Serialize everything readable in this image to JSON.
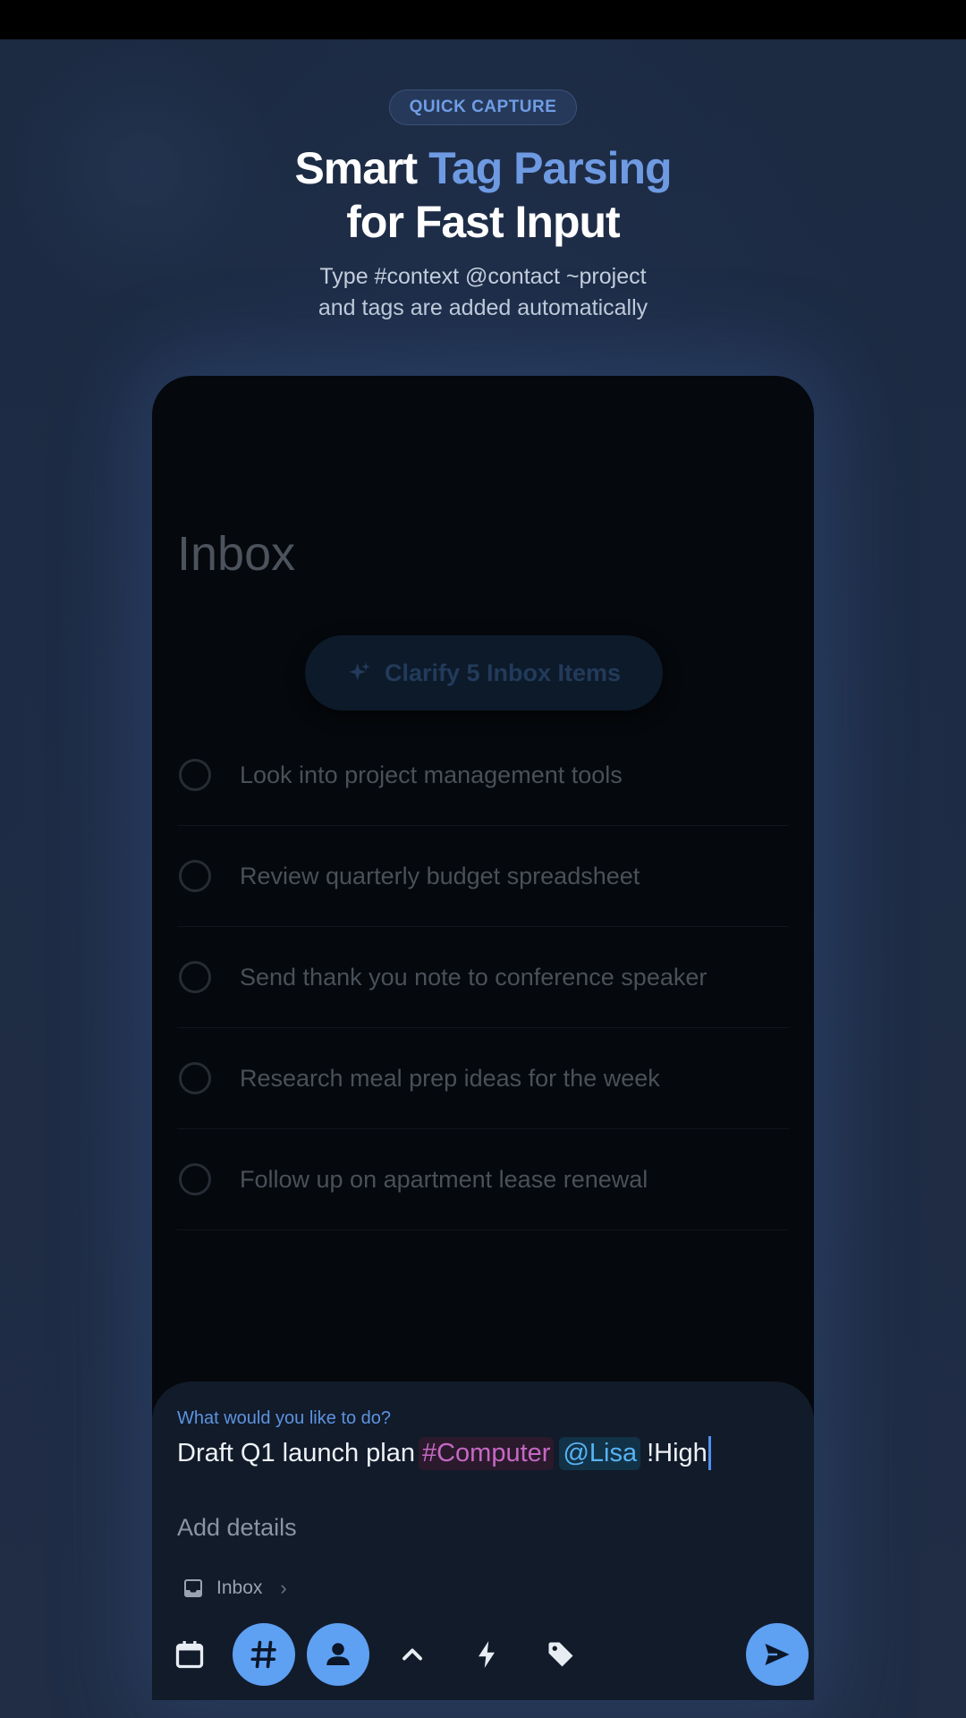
{
  "hero": {
    "badge": "QUICK CAPTURE",
    "title_part1": "Smart ",
    "title_accent": "Tag Parsing",
    "title_line2": "for Fast Input",
    "subtitle_line1": "Type #context @contact ~project",
    "subtitle_line2": "and tags are added automatically"
  },
  "screen": {
    "title": "Inbox",
    "clarify_label": "Clarify 5 Inbox Items",
    "items": [
      "Look into project management tools",
      "Review quarterly budget spreadsheet",
      "Send thank you note to conference speaker",
      "Research meal prep ideas for the week",
      "Follow up on apartment lease renewal"
    ]
  },
  "capture": {
    "prompt": "What would you like to do?",
    "text": "Draft Q1 launch plan",
    "context_tag": "#Computer",
    "contact_tag": "@Lisa",
    "priority": "!High",
    "details_placeholder": "Add details",
    "project": "Inbox"
  },
  "toolbar": {
    "icons": [
      "calendar-icon",
      "hash-icon",
      "person-icon",
      "chevron-up-icon",
      "bolt-icon",
      "tag-icon",
      "send-icon"
    ]
  },
  "colors": {
    "accent": "#6e9ae2",
    "button": "#5ea0f2",
    "context_tag": "#c568c4",
    "contact_tag": "#57b3f2"
  }
}
